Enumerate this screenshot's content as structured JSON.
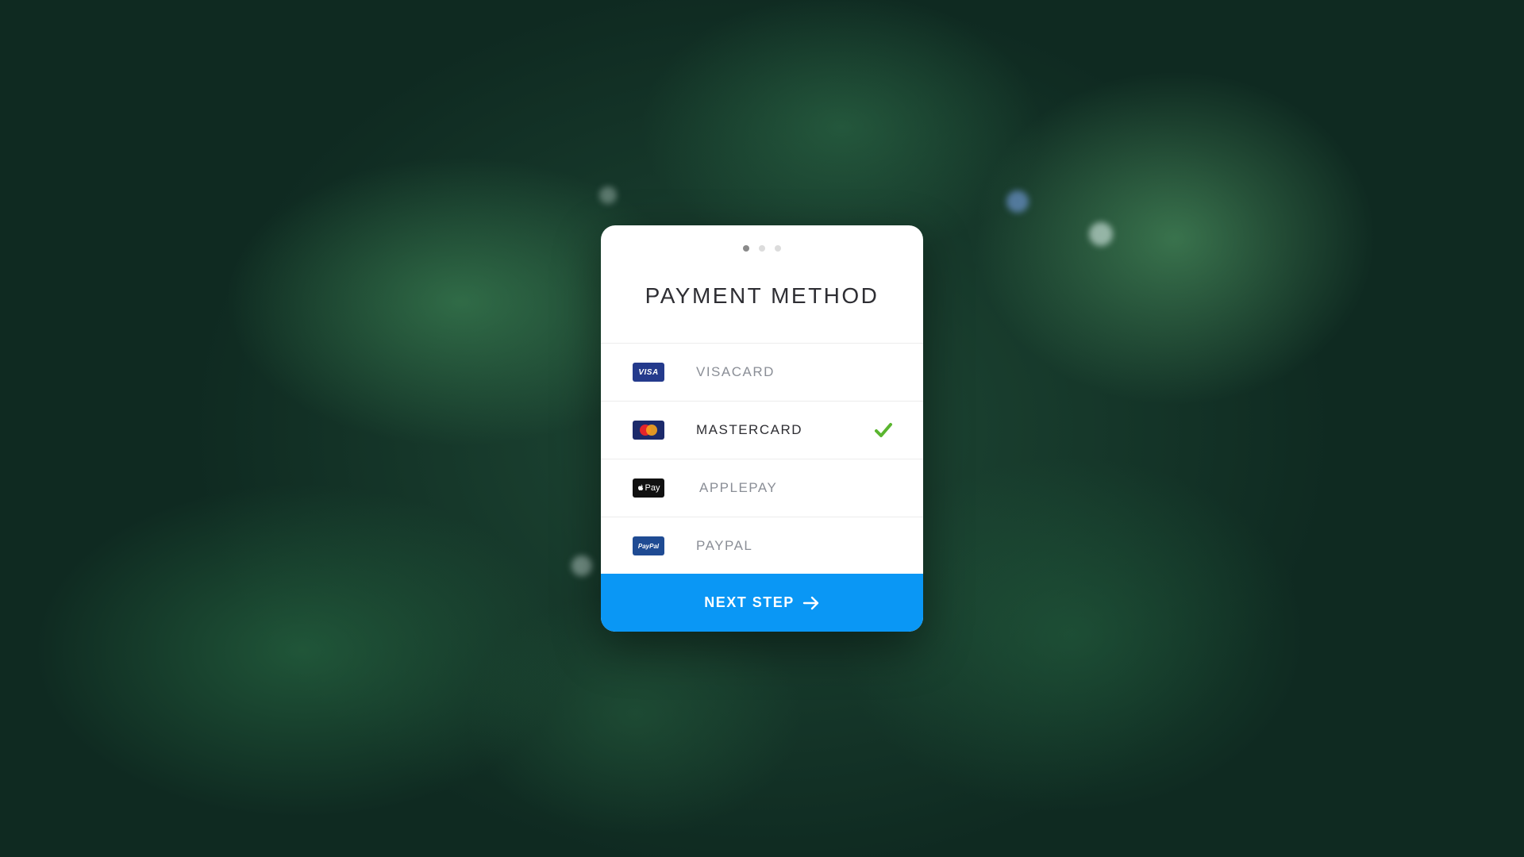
{
  "colors": {
    "accent": "#0a97f5",
    "check": "#5ab52f",
    "card_bg": "#ffffff"
  },
  "steps": {
    "total": 3,
    "current": 1
  },
  "title": "PAYMENT METHOD",
  "methods": [
    {
      "name": "VISACARD",
      "logo_text": "VISA",
      "icon": "visa-logo-icon",
      "selected": false
    },
    {
      "name": "MASTERCARD",
      "logo_text": "MasterCard",
      "icon": "mastercard-logo-icon",
      "selected": true
    },
    {
      "name": "APPLEPAY",
      "logo_text": "Pay",
      "icon": "applepay-logo-icon",
      "selected": false
    },
    {
      "name": "PAYPAL",
      "logo_text": "PayPal",
      "icon": "paypal-logo-icon",
      "selected": false
    }
  ],
  "next_button": {
    "label": "NEXT STEP",
    "icon": "arrow-right-icon"
  }
}
